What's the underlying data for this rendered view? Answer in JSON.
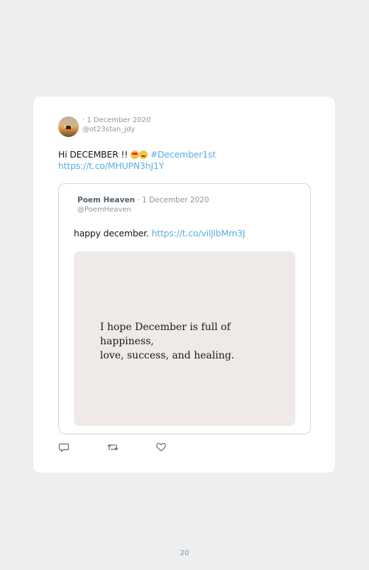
{
  "tweet": {
    "date_line": "· 1 December 2020",
    "handle": "@ot23stan_jdy",
    "text_start": "Hi DECEMBER !! ",
    "hashtag": "#December1st",
    "link": "https://t.co/MHUPN3hJ1Y",
    "emojis": [
      "smiling-face-with-heart-eyes",
      "smiling-face-with-halo"
    ]
  },
  "quoted_tweet": {
    "author_name": "Poem Heaven",
    "date_line": " · 1 December 2020",
    "handle": "@PoemHeaven",
    "text": "happy december. ",
    "link": "https://t.co/vilJlbMm3J",
    "image_text_line1": "I hope December is full of happiness,",
    "image_text_line2": "love, success, and healing."
  },
  "actions": {
    "icons": [
      "reply-icon",
      "retweet-icon",
      "like-icon"
    ]
  },
  "page": {
    "number": "20"
  },
  "colors": {
    "background": "#eceeef",
    "card": "#ffffff",
    "link": "#5aaee0",
    "muted": "#8a959e",
    "quote_image_bg": "#efe9e8"
  }
}
